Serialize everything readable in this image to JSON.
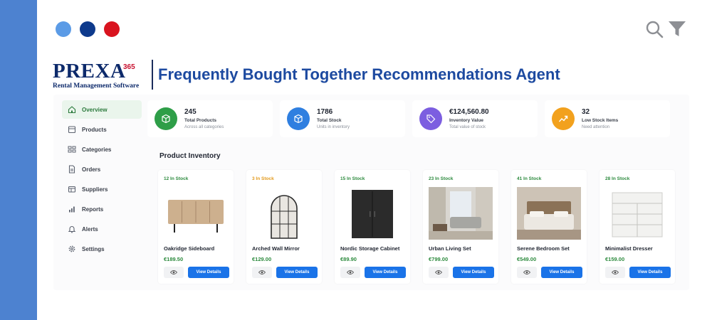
{
  "window": {
    "dots": [
      "#5b9be6",
      "#0e3a8c",
      "#d9141f"
    ],
    "icons": [
      "search-icon",
      "filter-icon"
    ]
  },
  "brand": {
    "logo_word_main": "PREXA",
    "logo_number": "365",
    "logo_tagline": "Rental Management Software",
    "headline": "Frequently Bought Together Recommendations Agent"
  },
  "sidebar": {
    "items": [
      {
        "label": "Overview",
        "icon": "home-icon",
        "active": true
      },
      {
        "label": "Products",
        "icon": "box-icon"
      },
      {
        "label": "Categories",
        "icon": "grid-icon"
      },
      {
        "label": "Orders",
        "icon": "document-icon"
      },
      {
        "label": "Suppliers",
        "icon": "truck-icon"
      },
      {
        "label": "Reports",
        "icon": "bar-chart-icon"
      },
      {
        "label": "Alerts",
        "icon": "bell-icon"
      },
      {
        "label": "Settings",
        "icon": "gear-icon"
      }
    ]
  },
  "stats": [
    {
      "value": "245",
      "label": "Total Products",
      "sub": "Across all categories",
      "color": "#2e9e48",
      "icon": "cube-icon"
    },
    {
      "value": "1786",
      "label": "Total Stock",
      "sub": "Units in inventory",
      "color": "#2f7fe0",
      "icon": "package-icon"
    },
    {
      "value": "€124,560.80",
      "label": "Inventory Value",
      "sub": "Total value of stock",
      "color": "#7c5ee0",
      "icon": "tag-icon"
    },
    {
      "value": "32",
      "label": "Low Stock Items",
      "sub": "Need attention",
      "color": "#f2a11d",
      "icon": "trend-up-icon"
    }
  ],
  "inventory": {
    "title": "Product Inventory",
    "view_label": "View Details",
    "products": [
      {
        "stock": "12 In Stock",
        "stock_color": "#2c8a3d",
        "name": "Oakridge Sideboard",
        "price": "€189.50",
        "image": "sideboard-image"
      },
      {
        "stock": "3 In Stock",
        "stock_color": "#e39a1c",
        "name": "Arched Wall Mirror",
        "price": "€129.00",
        "image": "mirror-image"
      },
      {
        "stock": "15 In Stock",
        "stock_color": "#2c8a3d",
        "name": "Nordic Storage Cabinet",
        "price": "€89.90",
        "image": "cabinet-image"
      },
      {
        "stock": "23 In Stock",
        "stock_color": "#2c8a3d",
        "name": "Urban Living Set",
        "price": "€799.00",
        "image": "living-room-image"
      },
      {
        "stock": "41 In Stock",
        "stock_color": "#2c8a3d",
        "name": "Serene Bedroom Set",
        "price": "€549.00",
        "image": "bedroom-image"
      },
      {
        "stock": "28 In Stock",
        "stock_color": "#2c8a3d",
        "name": "Minimalist Dresser",
        "price": "€159.00",
        "image": "dresser-image"
      }
    ]
  }
}
